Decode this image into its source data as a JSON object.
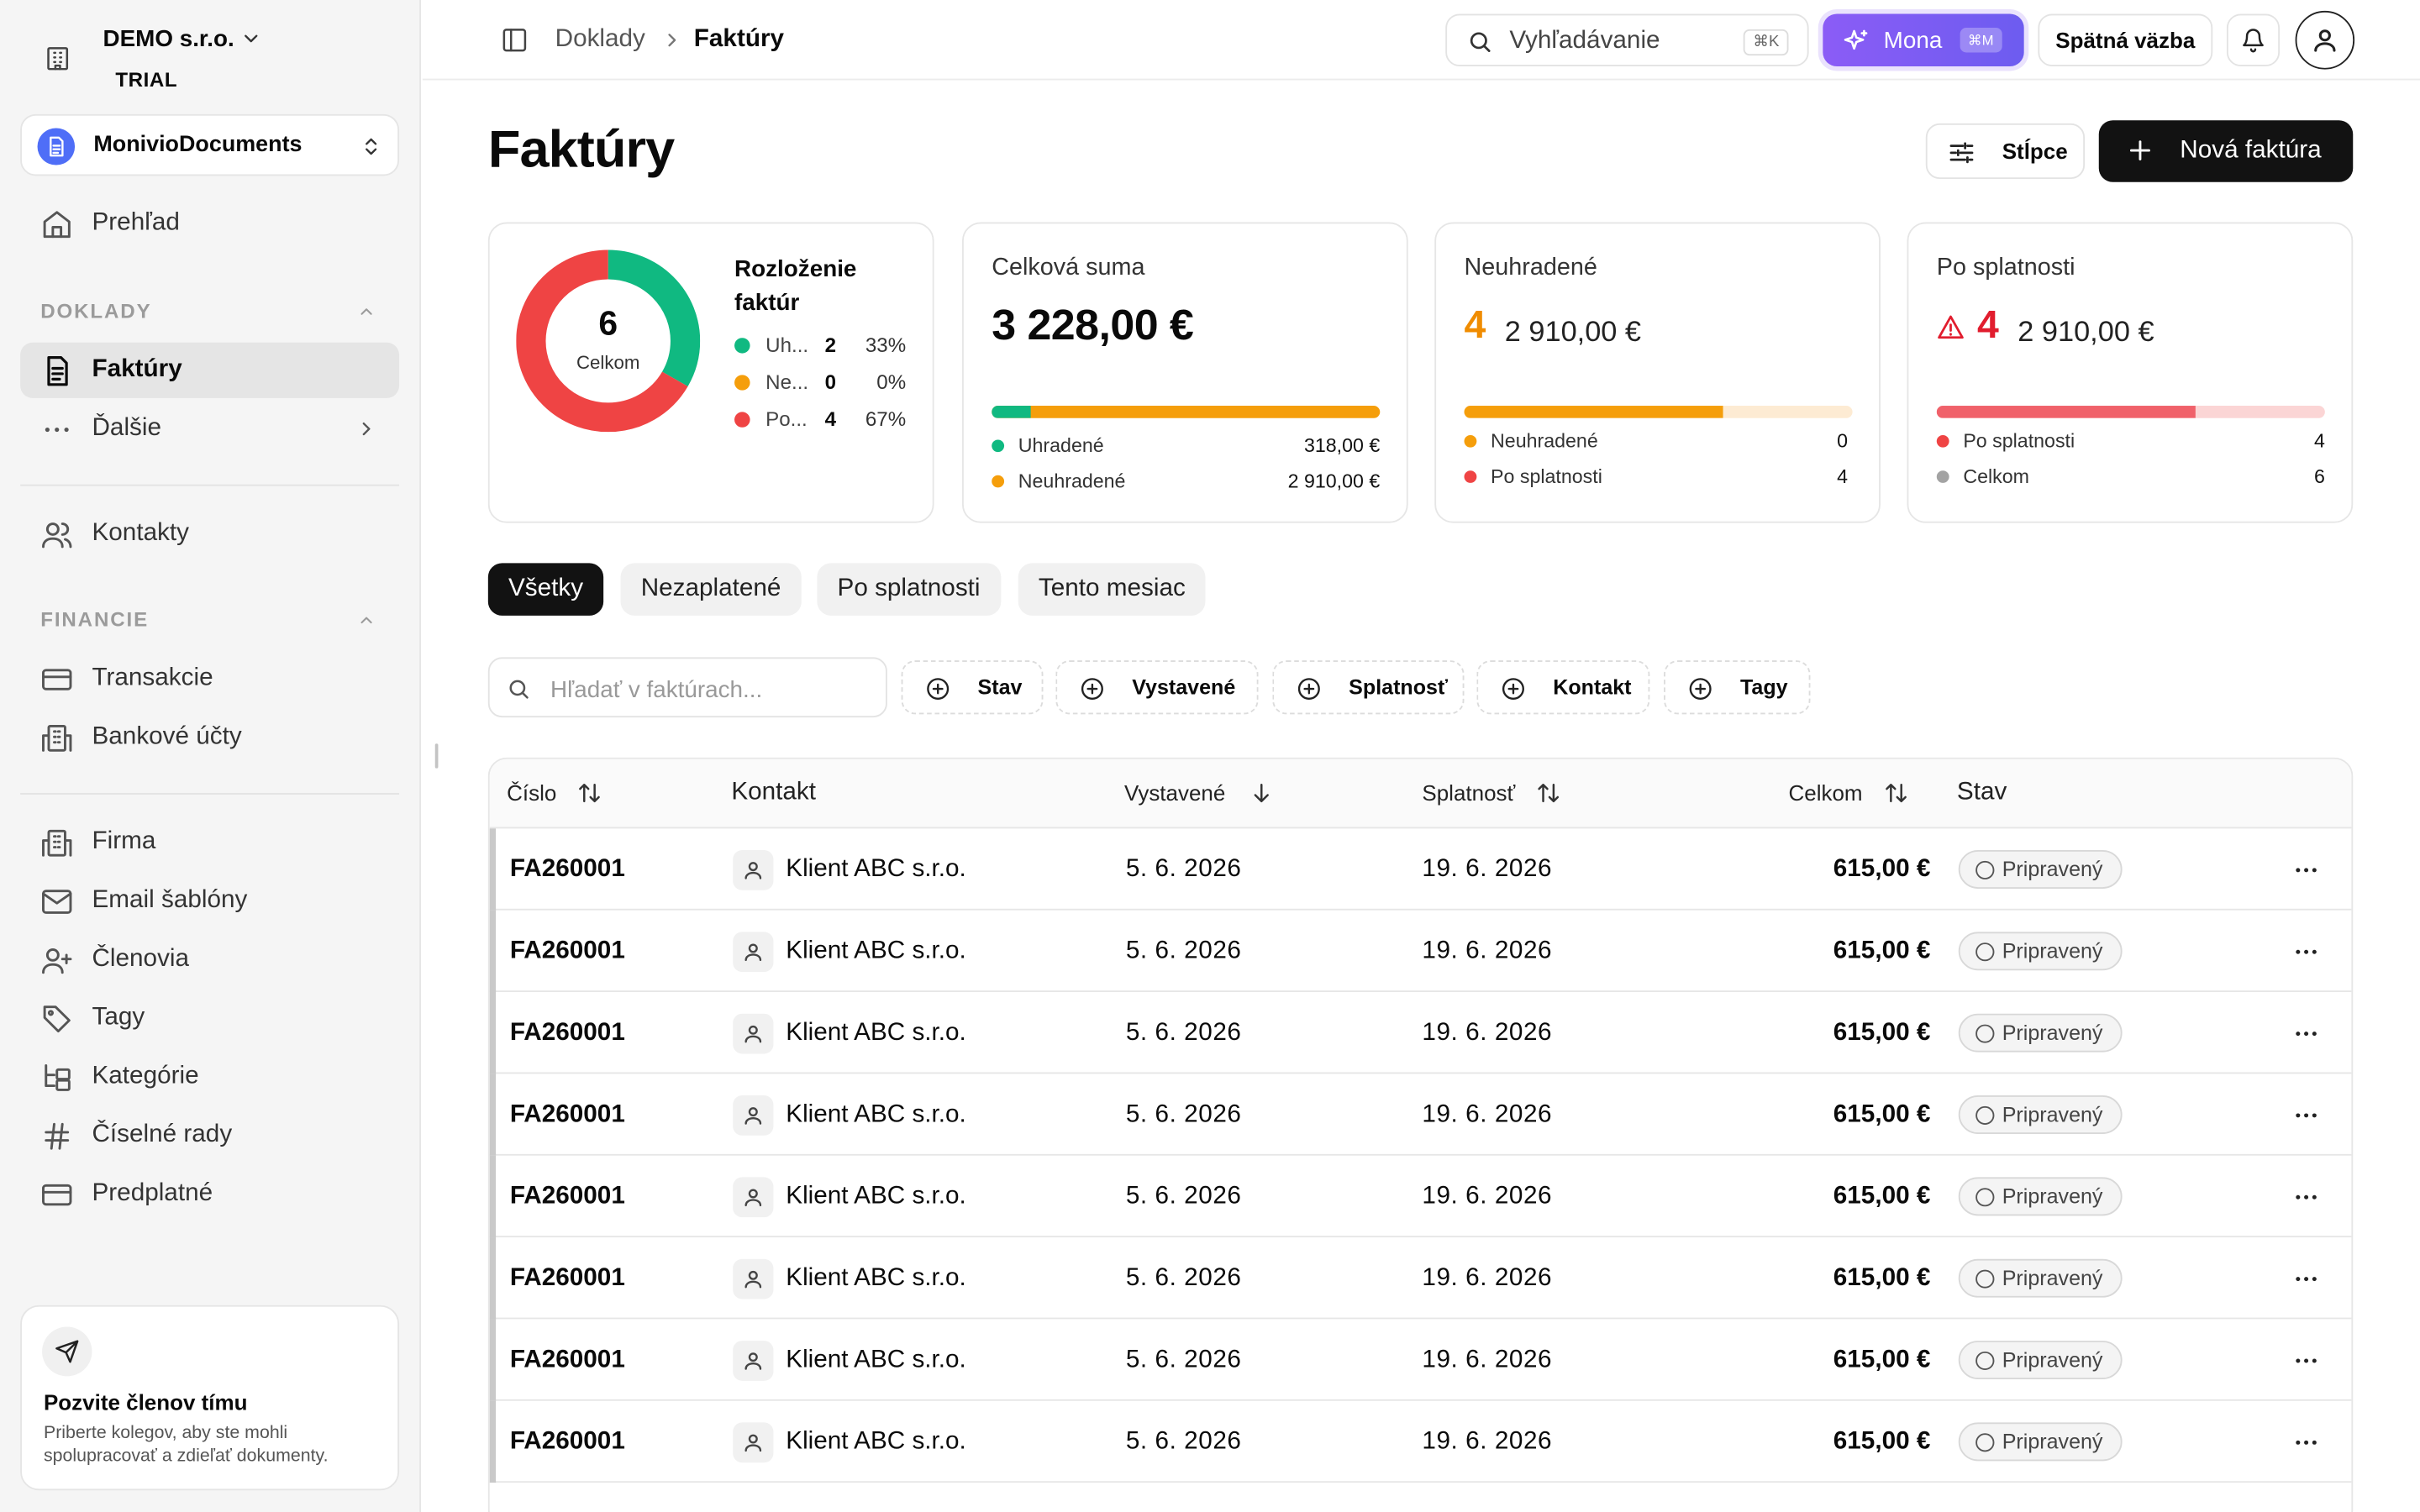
{
  "org": {
    "name": "DEMO s.r.o.",
    "plan": "TRIAL"
  },
  "workspace": {
    "name": "MonivioDocuments"
  },
  "nav": {
    "overview": "Prehľad",
    "section_documents": "DOKLADY",
    "invoices": "Faktúry",
    "more": "Ďalšie",
    "contacts": "Kontakty",
    "section_finance": "FINANCIE",
    "transactions": "Transakcie",
    "bank_accounts": "Bankové účty",
    "company": "Firma",
    "email_templates": "Email šablóny",
    "members": "Členovia",
    "tags": "Tagy",
    "categories": "Kategórie",
    "number_series": "Číselné rady",
    "subscription": "Predplatné"
  },
  "invite": {
    "title": "Pozvite členov tímu",
    "text": "Priberte kolegov, aby ste mohli spolupracovať a zdieľať dokumenty."
  },
  "topbar": {
    "breadcrumb_parent": "Doklady",
    "breadcrumb_current": "Faktúry",
    "search_placeholder": "Vyhľadávanie",
    "search_shortcut": "⌘K",
    "mona_label": "Mona",
    "mona_shortcut": "⌘M",
    "feedback_label": "Spätná väzba"
  },
  "page": {
    "title": "Faktúry",
    "columns_label": "Stĺpce",
    "new_invoice_label": "Nová faktúra"
  },
  "distribution": {
    "title": "Rozloženie faktúr",
    "total": "6",
    "total_label": "Celkom",
    "items": [
      {
        "label": "Uh...",
        "count": "2",
        "percent": "33%",
        "color": "#10b981",
        "share": 0.333
      },
      {
        "label": "Ne...",
        "count": "0",
        "percent": "0%",
        "color": "#f59e0b",
        "share": 0
      },
      {
        "label": "Po...",
        "count": "4",
        "percent": "67%",
        "color": "#ef4444",
        "share": 0.667
      }
    ]
  },
  "total_card": {
    "title": "Celková suma",
    "amount": "3 228,00 €",
    "paid_fraction": 0.0985,
    "legend": [
      {
        "label": "Uhradené",
        "value": "318,00 €",
        "color": "#10b981"
      },
      {
        "label": "Neuhradené",
        "value": "2 910,00 €",
        "color": "#f59e0b"
      }
    ]
  },
  "unpaid_card": {
    "title": "Neuhradené",
    "count": "4",
    "amount": "2 910,00 €",
    "fill_fraction": 0.667,
    "color": "#f08c00",
    "legend": [
      {
        "label": "Neuhradené",
        "value": "0",
        "color": "#f59e0b"
      },
      {
        "label": "Po splatnosti",
        "value": "4",
        "color": "#ef4444"
      }
    ]
  },
  "overdue_card": {
    "title": "Po splatnosti",
    "count": "4",
    "amount": "2 910,00 €",
    "fill_fraction": 0.667,
    "color": "#e11d2e",
    "legend": [
      {
        "label": "Po splatnosti",
        "value": "4",
        "color": "#ef4444"
      },
      {
        "label": "Celkom",
        "value": "6",
        "color": "#a3a3a3"
      }
    ]
  },
  "tabs": [
    {
      "label": "Všetky",
      "active": true
    },
    {
      "label": "Nezaplatené",
      "active": false
    },
    {
      "label": "Po splatnosti",
      "active": false
    },
    {
      "label": "Tento mesiac",
      "active": false
    }
  ],
  "filters": {
    "search_placeholder": "Hľadať v faktúrach...",
    "chips": [
      "Stav",
      "Vystavené",
      "Splatnosť",
      "Kontakt",
      "Tagy"
    ]
  },
  "table": {
    "columns": {
      "number": "Číslo",
      "contact": "Kontakt",
      "issued": "Vystavené",
      "due": "Splatnosť",
      "total": "Celkom",
      "status": "Stav"
    },
    "rows": [
      {
        "number": "FA260001",
        "contact": "Klient ABC s.r.o.",
        "issued": "5. 6. 2026",
        "due": "19. 6. 2026",
        "total": "615,00 €",
        "status": "Pripravený"
      },
      {
        "number": "FA260001",
        "contact": "Klient ABC s.r.o.",
        "issued": "5. 6. 2026",
        "due": "19. 6. 2026",
        "total": "615,00 €",
        "status": "Pripravený"
      },
      {
        "number": "FA260001",
        "contact": "Klient ABC s.r.o.",
        "issued": "5. 6. 2026",
        "due": "19. 6. 2026",
        "total": "615,00 €",
        "status": "Pripravený"
      },
      {
        "number": "FA260001",
        "contact": "Klient ABC s.r.o.",
        "issued": "5. 6. 2026",
        "due": "19. 6. 2026",
        "total": "615,00 €",
        "status": "Pripravený"
      },
      {
        "number": "FA260001",
        "contact": "Klient ABC s.r.o.",
        "issued": "5. 6. 2026",
        "due": "19. 6. 2026",
        "total": "615,00 €",
        "status": "Pripravený"
      },
      {
        "number": "FA260001",
        "contact": "Klient ABC s.r.o.",
        "issued": "5. 6. 2026",
        "due": "19. 6. 2026",
        "total": "615,00 €",
        "status": "Pripravený"
      },
      {
        "number": "FA260001",
        "contact": "Klient ABC s.r.o.",
        "issued": "5. 6. 2026",
        "due": "19. 6. 2026",
        "total": "615,00 €",
        "status": "Pripravený"
      },
      {
        "number": "FA260001",
        "contact": "Klient ABC s.r.o.",
        "issued": "5. 6. 2026",
        "due": "19. 6. 2026",
        "total": "615,00 €",
        "status": "Pripravený"
      }
    ]
  }
}
